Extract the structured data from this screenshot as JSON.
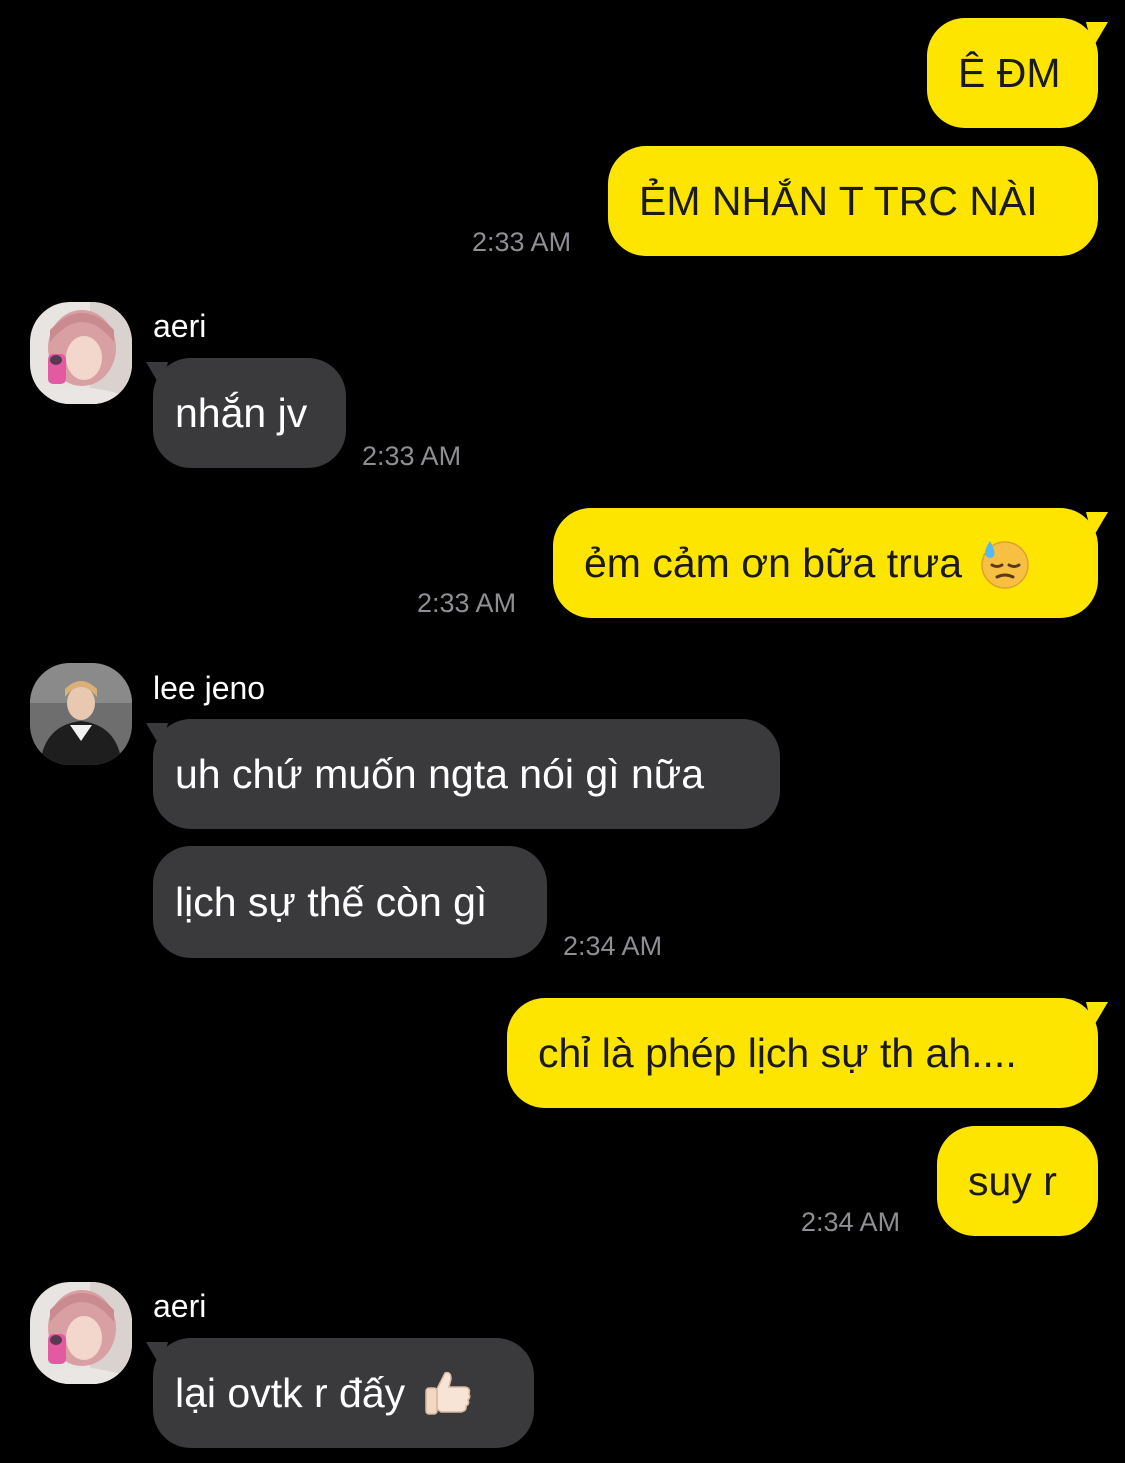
{
  "conversation": {
    "messages": [
      {
        "sender": "me",
        "text": "Ê ĐM"
      },
      {
        "sender": "me",
        "text": "ẺM NHẮN T TRC NÀI",
        "time": "2:33 AM"
      },
      {
        "sender": "aeri",
        "name": "aeri",
        "text": "nhắn jv",
        "time": "2:33 AM"
      },
      {
        "sender": "me",
        "text": "ẻm cảm ơn bữa trưa",
        "emoji": "downcast-face-with-sweat-icon",
        "time": "2:33 AM"
      },
      {
        "sender": "jeno",
        "name": "lee jeno",
        "text": "uh chứ muốn ngta nói gì nữa"
      },
      {
        "sender": "jeno",
        "text": "lịch sự thế còn gì",
        "time": "2:34 AM"
      },
      {
        "sender": "me",
        "text": "chỉ là phép lịch sự th ah...."
      },
      {
        "sender": "me",
        "text": "suy r",
        "time": "2:34 AM"
      },
      {
        "sender": "aeri",
        "name": "aeri",
        "text": "lại ovtk r đấy",
        "emoji": "thumbs-up-icon"
      }
    ]
  },
  "colors": {
    "background": "#000000",
    "outgoing_bubble": "#FEE500",
    "incoming_bubble": "#3a3a3c",
    "timestamp": "#8e8e93"
  }
}
